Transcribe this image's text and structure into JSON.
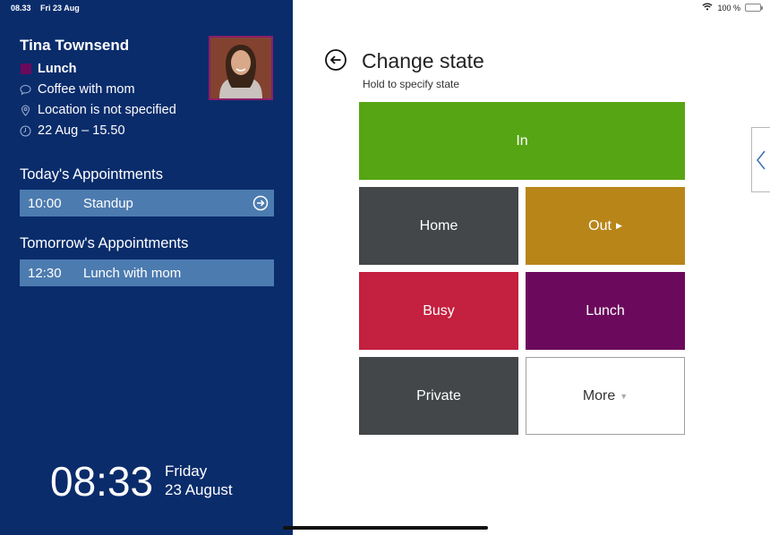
{
  "status_bar": {
    "time": "08.33",
    "date": "Fri 23 Aug",
    "battery": "100 %"
  },
  "user": {
    "name": "Tina Townsend",
    "state": "Lunch",
    "state_color": "#6b0a5c",
    "message": "Coffee with mom",
    "location": "Location is not specified",
    "until": "22 Aug – 15.50"
  },
  "today": {
    "title": "Today's Appointments",
    "items": [
      {
        "time": "10:00",
        "title": "Standup"
      }
    ]
  },
  "tomorrow": {
    "title": "Tomorrow's Appointments",
    "items": [
      {
        "time": "12:30",
        "title": "Lunch with mom"
      }
    ]
  },
  "clock": {
    "time": "08:33",
    "weekday": "Friday",
    "date": "23 August"
  },
  "change_state": {
    "title": "Change state",
    "subtitle": "Hold to specify state",
    "tiles": {
      "in": {
        "label": "In",
        "color": "#56a514"
      },
      "home": {
        "label": "Home",
        "color": "#43474a"
      },
      "out": {
        "label": "Out",
        "color": "#b88519"
      },
      "busy": {
        "label": "Busy",
        "color": "#c4203f"
      },
      "lunch": {
        "label": "Lunch",
        "color": "#6b0a5c"
      },
      "private": {
        "label": "Private",
        "color": "#43474a"
      },
      "more": {
        "label": "More",
        "color": "#ffffff"
      }
    }
  },
  "colors": {
    "panel": "#0a2c6b",
    "appointment_bar": "#4c7bb0"
  }
}
